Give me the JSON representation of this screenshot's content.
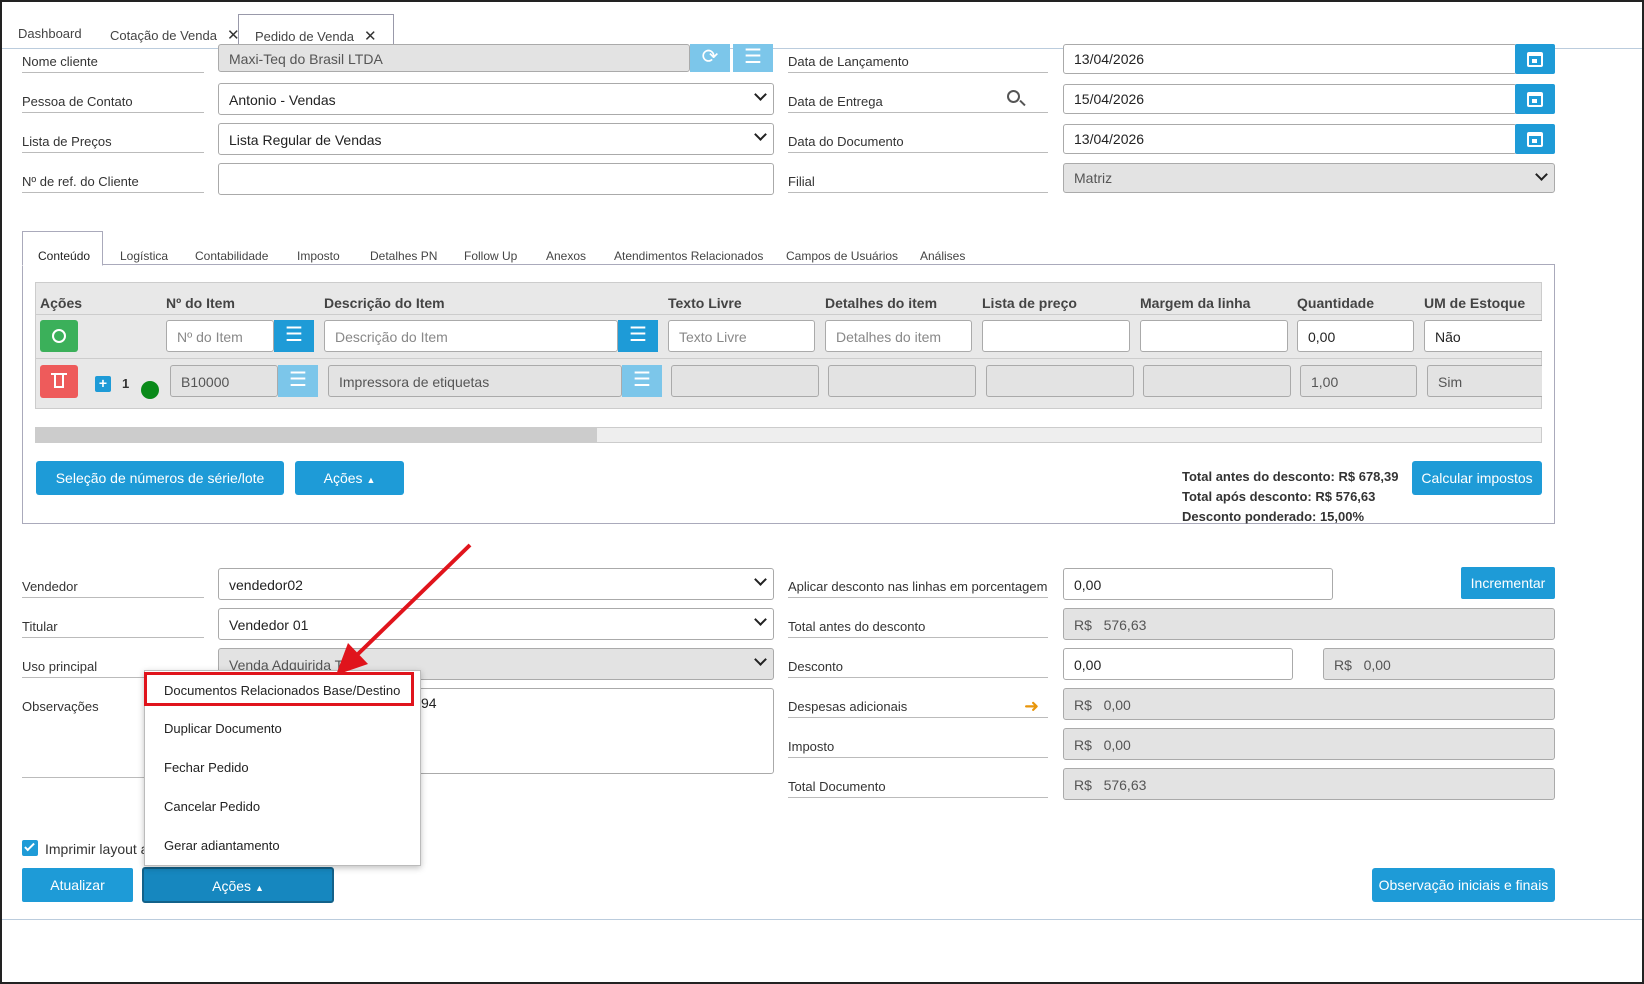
{
  "tabs": [
    {
      "label": "Dashboard"
    },
    {
      "label": "Cotação de Venda"
    },
    {
      "label": "Pedido de Venda"
    }
  ],
  "header": {
    "nome_cliente_label": "Nome cliente",
    "nome_cliente": "Maxi-Teq do Brasil LTDA",
    "pessoa_label": "Pessoa de Contato",
    "pessoa": "Antonio - Vendas",
    "lista_label": "Lista de Preços",
    "lista": "Lista Regular de Vendas",
    "ref_label": "Nº de ref. do Cliente",
    "ref": "",
    "lanc_label": "Data de Lançamento",
    "lanc": "13/04/2026",
    "entrega_label": "Data de Entrega",
    "entrega": "15/04/2026",
    "doc_label": "Data do Documento",
    "doc": "13/04/2026",
    "filial_label": "Filial",
    "filial": "Matriz"
  },
  "section_tabs": [
    "Conteúdo",
    "Logística",
    "Contabilidade",
    "Imposto",
    "Detalhes PN",
    "Follow Up",
    "Anexos",
    "Atendimentos Relacionados",
    "Campos de Usuários",
    "Análises"
  ],
  "grid": {
    "columns": [
      "Ações",
      "Nº do Item",
      "Descrição do Item",
      "Texto Livre",
      "Detalhes do item",
      "Lista de preço",
      "Margem da linha",
      "Quantidade",
      "UM de Estoque"
    ],
    "new_row": {
      "item_ph": "Nº do Item",
      "desc_ph": "Descrição do Item",
      "texto_ph": "Texto Livre",
      "detalhes_ph": "Detalhes do item",
      "qtd": "0,00",
      "um": "Não"
    },
    "row": {
      "num": "1",
      "item": "B10000",
      "desc": "Impressora de etiquetas",
      "qtd": "1,00",
      "um": "Sim"
    }
  },
  "content_buttons": {
    "serie": "Seleção de números de série/lote",
    "acoes": "Ações",
    "calcular": "Calcular impostos"
  },
  "totals": {
    "antes": "Total antes do desconto: R$ 678,39",
    "apos": "Total após desconto: R$ 576,63",
    "ponderado": "Desconto ponderado: 15,00%"
  },
  "footer": {
    "vendedor_label": "Vendedor",
    "vendedor": "vendedor02",
    "titular_label": "Titular",
    "titular": "Vendedor 01",
    "uso_label": "Uso principal",
    "uso": "Venda Adquirida T",
    "obs_label": "Observações",
    "obs_visible": "94",
    "aplicar_label": "Aplicar desconto nas linhas em porcentagem",
    "aplicar": "0,00",
    "incrementar": "Incrementar",
    "total_antes_label": "Total antes do desconto",
    "currency": "R$",
    "total_antes": "576,63",
    "desconto_label": "Desconto",
    "desconto": "0,00",
    "desconto_valor": "0,00",
    "despesas_label": "Despesas adicionais",
    "despesas": "0,00",
    "imposto_label": "Imposto",
    "imposto": "0,00",
    "total_doc_label": "Total Documento",
    "total_doc": "576,63",
    "imprimir": "Imprimir layout a"
  },
  "bottom": {
    "atualizar": "Atualizar",
    "acoes": "Ações",
    "obs_btn": "Observação iniciais e finais"
  },
  "dropdown": [
    "Documentos Relacionados Base/Destino",
    "Duplicar Documento",
    "Fechar Pedido",
    "Cancelar Pedido",
    "Gerar adiantamento"
  ],
  "colors": {
    "accent": "#1e9bd7",
    "highlight": "#e0141c"
  }
}
